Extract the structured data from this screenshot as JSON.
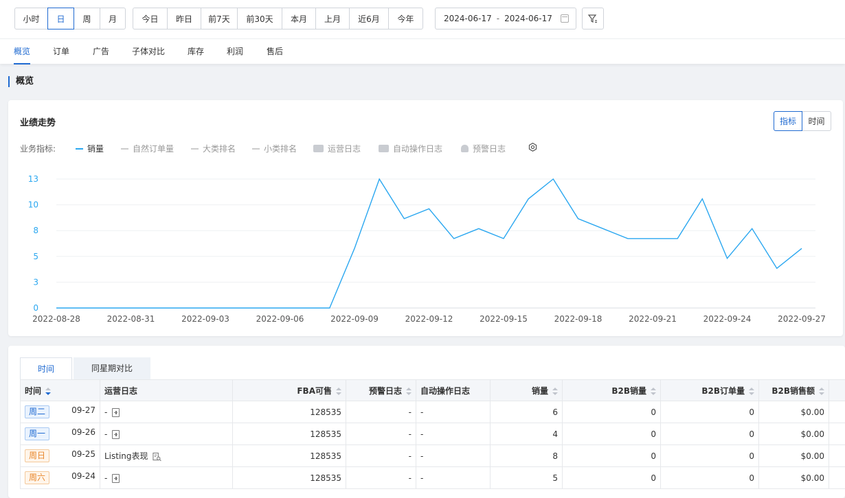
{
  "granularity": {
    "items": [
      "小时",
      "日",
      "周",
      "月"
    ],
    "active": 1
  },
  "quick_ranges": {
    "items": [
      "今日",
      "昨日",
      "前7天",
      "前30天",
      "本月",
      "上月",
      "近6月",
      "今年"
    ]
  },
  "date_range": {
    "start": "2024-06-17",
    "separator": "-",
    "end": "2024-06-17"
  },
  "nav_tabs": {
    "items": [
      "概览",
      "订单",
      "广告",
      "子体对比",
      "库存",
      "利润",
      "售后"
    ],
    "active": 0
  },
  "section_title": "概览",
  "performance": {
    "title": "业绩走势",
    "view_toggle": [
      "指标",
      "时间"
    ],
    "view_active": 0,
    "legend_label": "业务指标:",
    "legend": [
      {
        "label": "销量",
        "on": true,
        "kind": "line"
      },
      {
        "label": "自然订单量",
        "on": false,
        "kind": "line"
      },
      {
        "label": "大类排名",
        "on": false,
        "kind": "line"
      },
      {
        "label": "小类排名",
        "on": false,
        "kind": "line"
      },
      {
        "label": "运营日志",
        "on": false,
        "kind": "chat-icon"
      },
      {
        "label": "自动操作日志",
        "on": false,
        "kind": "monitor-icon"
      },
      {
        "label": "预警日志",
        "on": false,
        "kind": "bell-icon"
      }
    ],
    "settings_icon": "gear-icon",
    "line_color": "#2aa7f0"
  },
  "chart_data": {
    "type": "line",
    "x": [
      "2022-08-28",
      "2022-08-29",
      "2022-08-30",
      "2022-08-31",
      "2022-09-01",
      "2022-09-02",
      "2022-09-03",
      "2022-09-04",
      "2022-09-05",
      "2022-09-06",
      "2022-09-07",
      "2022-09-08",
      "2022-09-09",
      "2022-09-10",
      "2022-09-11",
      "2022-09-12",
      "2022-09-13",
      "2022-09-14",
      "2022-09-15",
      "2022-09-16",
      "2022-09-17",
      "2022-09-18",
      "2022-09-19",
      "2022-09-20",
      "2022-09-21",
      "2022-09-22",
      "2022-09-23",
      "2022-09-24",
      "2022-09-25",
      "2022-09-26",
      "2022-09-27"
    ],
    "x_tick_labels": [
      "2022-08-28",
      "2022-08-31",
      "2022-09-03",
      "2022-09-06",
      "2022-09-09",
      "2022-09-12",
      "2022-09-15",
      "2022-09-18",
      "2022-09-21",
      "2022-09-24",
      "2022-09-27"
    ],
    "y_tick_labels": [
      "0",
      "3",
      "5",
      "8",
      "10",
      "13"
    ],
    "ylim": [
      0,
      13
    ],
    "series": [
      {
        "name": "销量",
        "values": [
          0,
          0,
          0,
          0,
          0,
          0,
          0,
          0,
          0,
          0,
          0,
          0,
          6,
          13,
          9,
          10,
          7,
          8,
          7,
          11,
          13,
          9,
          8,
          7,
          7,
          7,
          11,
          5,
          8,
          4,
          6
        ]
      }
    ],
    "grid": true,
    "legend": "top-left"
  },
  "table": {
    "tabs": [
      "时间",
      "同星期对比"
    ],
    "active_tab": 0,
    "columns": [
      "时间",
      "运营日志",
      "FBA可售",
      "预警日志",
      "自动操作日志",
      "销量",
      "B2B销量",
      "B2B订单量",
      "B2B销售额"
    ],
    "rows": [
      {
        "weekday": "周二",
        "date": "09-27",
        "ops_log": "-",
        "fba": "128535",
        "warn": "-",
        "auto": "-",
        "sales": "6",
        "b2b_sales": "0",
        "b2b_orders": "0",
        "b2b_amount": "$0.00",
        "weekend": false
      },
      {
        "weekday": "周一",
        "date": "09-26",
        "ops_log": "-",
        "fba": "128535",
        "warn": "-",
        "auto": "-",
        "sales": "4",
        "b2b_sales": "0",
        "b2b_orders": "0",
        "b2b_amount": "$0.00",
        "weekend": false
      },
      {
        "weekday": "周日",
        "date": "09-25",
        "ops_log": "Listing表现",
        "fba": "128535",
        "warn": "-",
        "auto": "-",
        "sales": "8",
        "b2b_sales": "0",
        "b2b_orders": "0",
        "b2b_amount": "$0.00",
        "weekend": true
      },
      {
        "weekday": "周六",
        "date": "09-24",
        "ops_log": "-",
        "fba": "128535",
        "warn": "-",
        "auto": "-",
        "sales": "5",
        "b2b_sales": "0",
        "b2b_orders": "0",
        "b2b_amount": "$0.00",
        "weekend": true
      }
    ]
  }
}
